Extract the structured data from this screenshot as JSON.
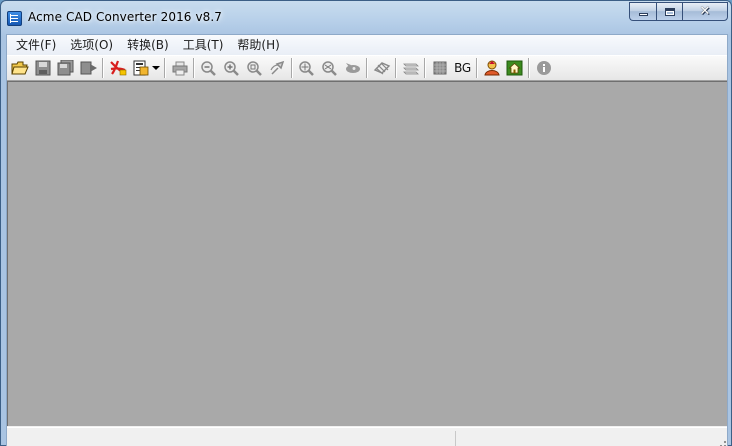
{
  "window": {
    "title": "Acme CAD Converter 2016 v8.7",
    "caption_close": "✕"
  },
  "menu": [
    {
      "label": "文件(F)"
    },
    {
      "label": "选项(O)"
    },
    {
      "label": "转换(B)"
    },
    {
      "label": "工具(T)"
    },
    {
      "label": "帮助(H)"
    }
  ],
  "toolbar": {
    "bg_label": "BG",
    "icons": [
      "open-folder-icon",
      "save-icon",
      "save-all-icon",
      "export-icon",
      "pdf-convert-icon",
      "batch-convert-icon",
      "print-icon",
      "zoom-out-icon",
      "zoom-in-icon",
      "zoom-window-icon",
      "pan-icon",
      "zoom-extents-icon",
      "zoom-previous-icon",
      "view-icon",
      "layers-icon",
      "layout-icon",
      "black-white-icon",
      "bg-color-button",
      "user-icon",
      "home-icon",
      "info-icon"
    ]
  },
  "colors": {
    "canvas_bg": "#a9a9a9",
    "titlebar": "#b9d1ea"
  }
}
